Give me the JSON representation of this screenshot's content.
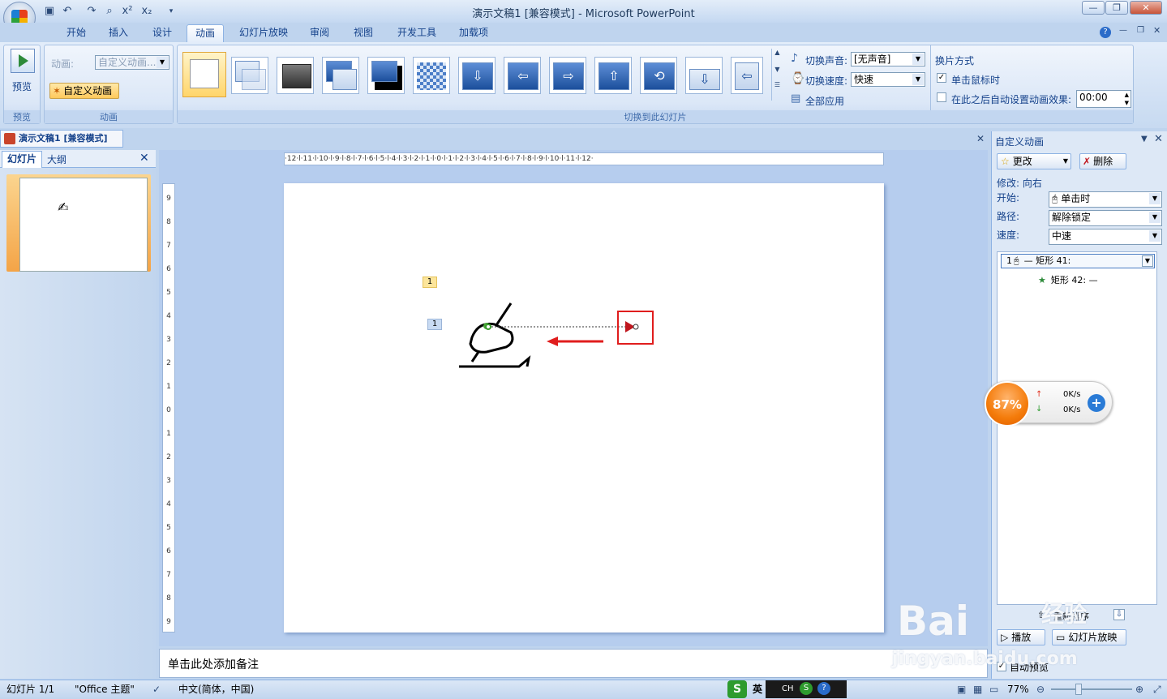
{
  "window": {
    "title": "演示文稿1 [兼容模式] - Microsoft PowerPoint"
  },
  "qat": {
    "icons": [
      "save-icon",
      "undo-icon",
      "redo-icon",
      "print-preview-icon",
      "superscript-icon",
      "subscript-icon"
    ],
    "superscript": "x²",
    "subscript": "x₂"
  },
  "tabs": [
    "开始",
    "插入",
    "设计",
    "动画",
    "幻灯片放映",
    "审阅",
    "视图",
    "开发工具",
    "加载项"
  ],
  "ribbon": {
    "preview_label": "预览",
    "preview_group": "预览",
    "anim_label": "动画:",
    "anim_value": "自定义动画...",
    "custom_anim_btn": "自定义动画",
    "anim_group": "动画",
    "transition_group": "切换到此幻灯片",
    "sound_label": "切换声音:",
    "sound_value": "[无声音]",
    "speed_label": "切换速度:",
    "speed_value": "快速",
    "apply_all": "全部应用",
    "advance_title": "换片方式",
    "on_click": "单击鼠标时",
    "after_auto": "在此之后自动设置动画效果:",
    "after_value": "00:00"
  },
  "doc_tab": "演示文稿1 [兼容模式]",
  "left_pane": {
    "tab_slides": "幻灯片",
    "tab_outline": "大纲",
    "slide_number": "1"
  },
  "ruler": {
    "h": "·12·l·11·l·10·l·9·l·8·l·7·l·6·l·5·l·4·l·3·l·2·l·1·l·0·l·1·l·2·l·3·l·4·l·5·l·6·l·7·l·8·l·9·l·10·l·11·l·12·",
    "v": [
      "9",
      "8",
      "7",
      "6",
      "5",
      "4",
      "3",
      "2",
      "1",
      "0",
      "1",
      "2",
      "3",
      "4",
      "5",
      "6",
      "7",
      "8",
      "9"
    ]
  },
  "slide": {
    "tag1": "1",
    "tag2": "1"
  },
  "notes_placeholder": "单击此处添加备注",
  "right_pane": {
    "title": "自定义动画",
    "change_btn": "更改",
    "delete_btn": "删除",
    "modify_label": "修改: 向右",
    "start_label": "开始:",
    "start_value": "单击时",
    "path_label": "路径:",
    "path_value": "解除锁定",
    "speed_label": "速度:",
    "speed_value": "中速",
    "items": [
      {
        "num": "1",
        "text": "— 矩形 41:"
      },
      {
        "text": "矩形 42: —"
      }
    ],
    "reorder_label": "重新排序",
    "play_btn": "播放",
    "slideshow_btn": "幻灯片放映",
    "autopreview": "自动预览"
  },
  "status": {
    "slide": "幻灯片 1/1",
    "theme": "\"Office 主题\"",
    "lang": "中文(简体，中国)",
    "zoom": "77%",
    "ime_en": "英",
    "ime_ch": "CH"
  },
  "speed_widget": {
    "percent": "87%",
    "up": "0K/s",
    "down": "0K/s"
  },
  "watermark": {
    "logo": "Bai",
    "text": "经验",
    "url": "jingyan.baidu.com"
  }
}
